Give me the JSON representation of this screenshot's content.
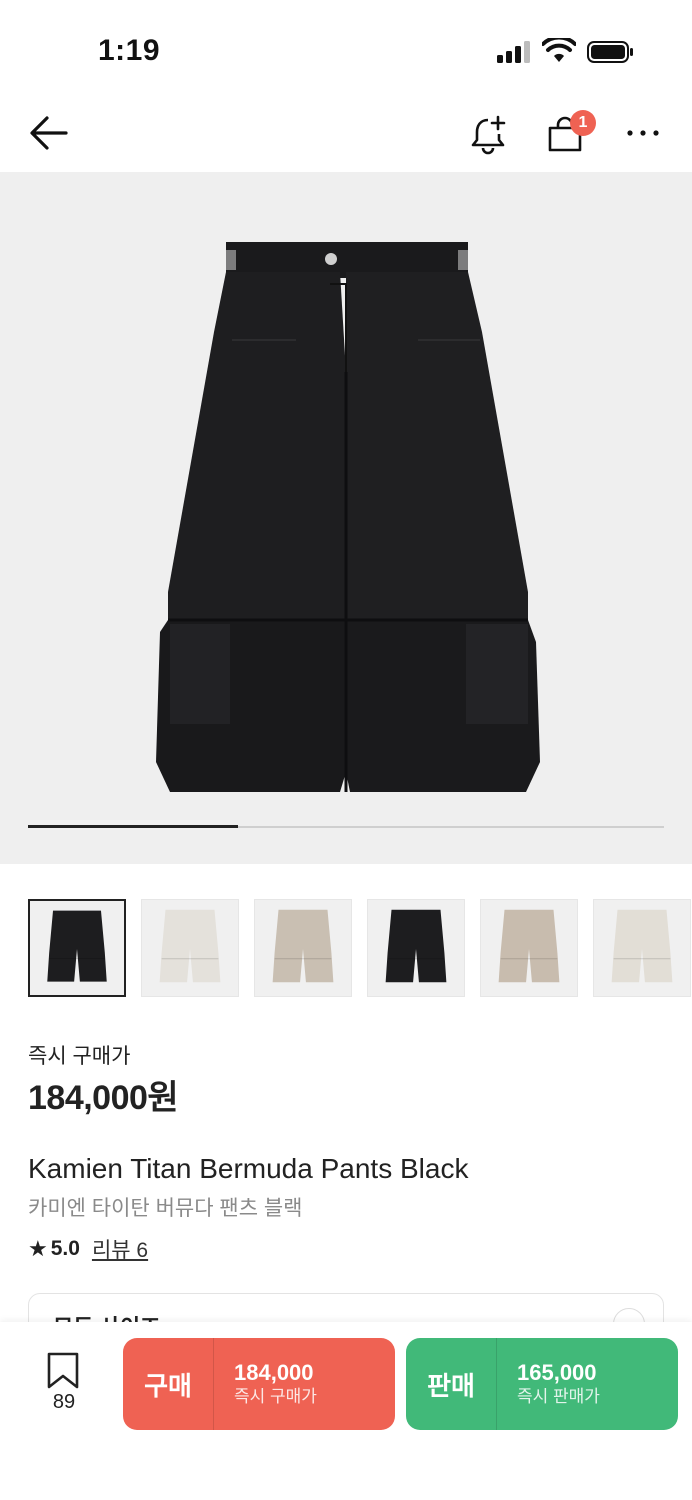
{
  "status_bar": {
    "time": "1:19"
  },
  "nav": {
    "icons": [
      "back-arrow-icon",
      "bell-plus-icon",
      "shopping-bag-icon",
      "more-icon"
    ],
    "cart_badge": "1"
  },
  "gallery": {
    "progress": 0.33,
    "thumbnails": [
      {
        "color": "#1d1d1f",
        "selected": true
      },
      {
        "color": "#e4e1db",
        "selected": false
      },
      {
        "color": "#c9bfb2",
        "selected": false
      },
      {
        "color": "#1d1d1f",
        "selected": false
      },
      {
        "color": "#c8bcae",
        "selected": false
      },
      {
        "color": "#e2ded6",
        "selected": false
      }
    ]
  },
  "price": {
    "label": "즉시 구매가",
    "value": "184,000원"
  },
  "product": {
    "name_en": "Kamien Titan Bermuda Pants Black",
    "name_ko": "카미엔 타이탄 버뮤다 팬츠 블랙"
  },
  "rating": {
    "score": "5.0",
    "review_text": "리뷰 6"
  },
  "size_selector": {
    "label": "모든 사이즈"
  },
  "bottom_bar": {
    "bookmark_count": "89",
    "buy": {
      "label": "구매",
      "amount": "184,000",
      "sub": "즉시 구매가",
      "color": "#ef6253"
    },
    "sell": {
      "label": "판매",
      "amount": "165,000",
      "sub": "즉시 판매가",
      "color": "#41b979"
    }
  }
}
